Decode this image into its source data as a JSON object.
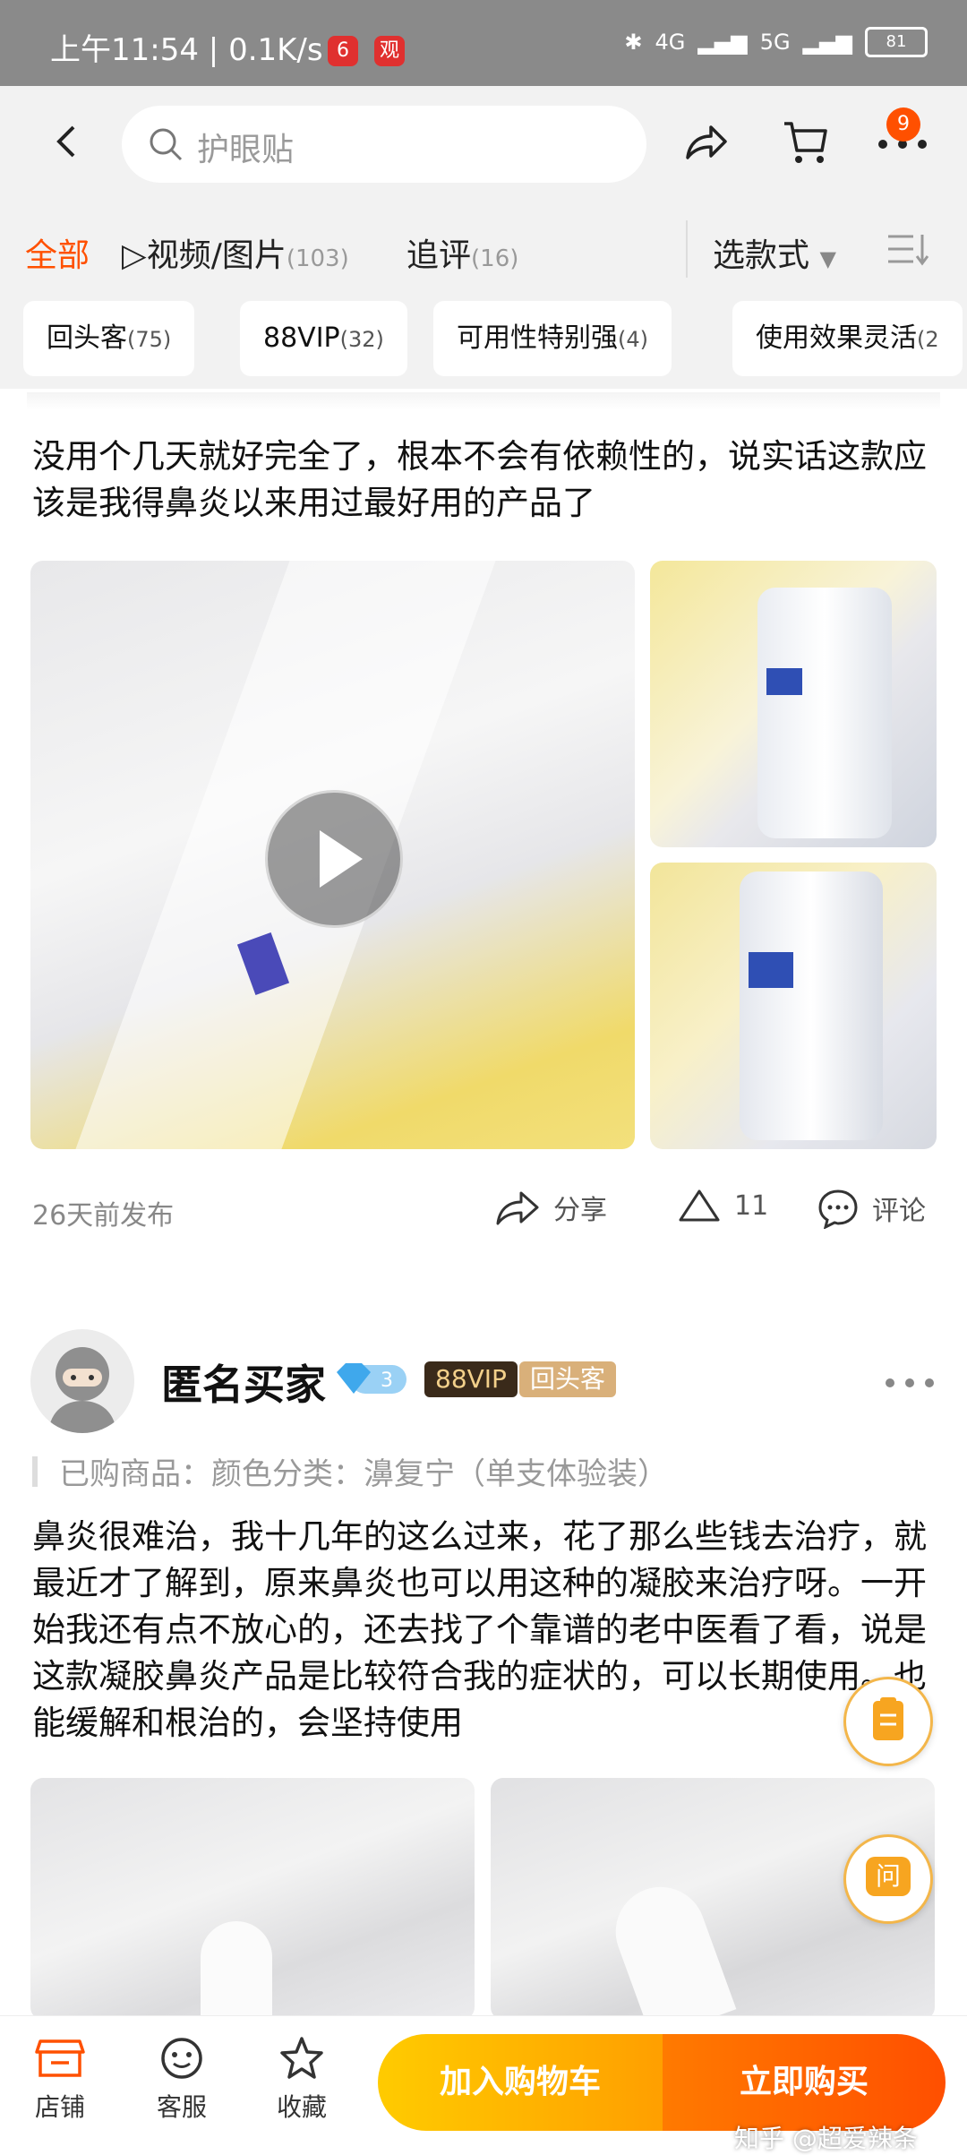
{
  "status_bar": {
    "time": "上午11:54",
    "speed": "0.1K/s",
    "app_badge_1": "6",
    "app_badge_2": "观",
    "net_1": "4G",
    "net_2": "5G",
    "battery": "81"
  },
  "header": {
    "search_placeholder": "护眼贴",
    "cart_count": "9"
  },
  "tabs": [
    {
      "label": "全部",
      "count": ""
    },
    {
      "label": "视频/图片",
      "count": "(103)"
    },
    {
      "label": "追评",
      "count": "(16)"
    }
  ],
  "sort_label": "选款式",
  "chips": [
    {
      "label": "回头客",
      "count": "(75)"
    },
    {
      "label": "88VIP",
      "count": "(32)"
    },
    {
      "label": "可用性特别强",
      "count": "(4)"
    },
    {
      "label": "使用效果灵活",
      "count": "(2"
    }
  ],
  "review1": {
    "text": "没用个几天就好完全了，根本不会有依赖性的，说实话这款应该是我得鼻炎以来用过最好用的产品了",
    "date": "26天前发布",
    "share": "分享",
    "likes": "11",
    "comment": "评论"
  },
  "review2": {
    "username": "匿名买家",
    "vip_level": "3",
    "vip_tag": "88VIP",
    "return_tag": "回头客",
    "purchased": "已购商品：颜色分类：濞复宁（单支体验装）",
    "text": "鼻炎很难治，我十几年的这么过来，花了那么些钱去治疗，就最近才了解到，原来鼻炎也可以用这种的凝胶来治疗呀。一开始我还有点不放心的，还去找了个靠谱的老中医看了看，说是这款凝胶鼻炎产品是比较符合我的症状的，可以长期使用。也能缓解和根治的，会坚持使用"
  },
  "float": {
    "ask": "问"
  },
  "bottom_bar": {
    "store": "店铺",
    "service": "客服",
    "favorite": "收藏",
    "add_cart": "加入购物车",
    "buy_now": "立即购买"
  },
  "watermark": "知乎 @超爱辣条"
}
